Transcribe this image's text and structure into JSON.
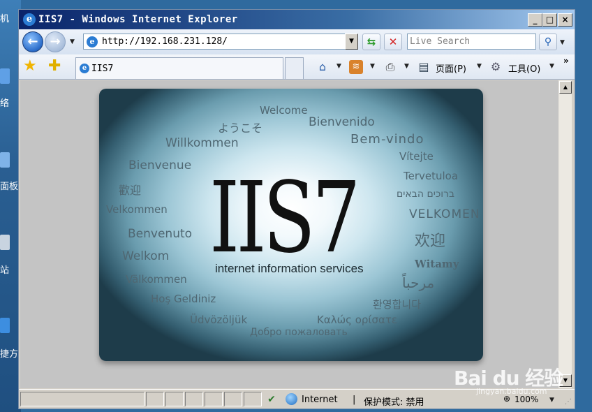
{
  "desktop": {
    "labels": [
      "机",
      "络",
      "面板",
      "站",
      "捷方"
    ]
  },
  "window": {
    "title": "IIS7 - Windows Internet Explorer",
    "caption_buttons": [
      "_",
      "□",
      "×"
    ]
  },
  "address_bar": {
    "url": "http://192.168.231.128/",
    "search_placeholder": "Live Search"
  },
  "command_bar": {
    "tab_title": "IIS7",
    "page_label": "页面(P)",
    "tools_label": "工具(O)",
    "overflow": "»"
  },
  "banner": {
    "title": "IIS7",
    "subtitle": "internet information services",
    "welcome_words": [
      "Welcome",
      "ようこそ",
      "Bienvenido",
      "Bem-vindo",
      "Willkommen",
      "Vítejte",
      "Bienvenue",
      "Tervetuloa",
      "歡迎",
      "ברוכים הבאים",
      "Velkommen",
      "VELKOMEN",
      "Benvenuto",
      "欢迎",
      "Welkom",
      "Witamy",
      "Välkommen",
      "مرحباً",
      "Hoş Geldiniz",
      "환영합니다",
      "Üdvözöljük",
      "Καλώς ορίσατε",
      "Добро пожаловать"
    ]
  },
  "status_bar": {
    "zone": "Internet",
    "separator": "|",
    "protected_mode": "保护模式: 禁用",
    "zoom": "100%"
  },
  "watermark": {
    "main": "Bai du 经验",
    "sub": "jingyan.baidu.com"
  },
  "colors": {
    "titlebar_start": "#0a246a",
    "titlebar_end": "#a6caf0",
    "desktop": "#2f6a9e",
    "chrome": "#d4d0c8",
    "content_bg": "#c4c4c4"
  }
}
